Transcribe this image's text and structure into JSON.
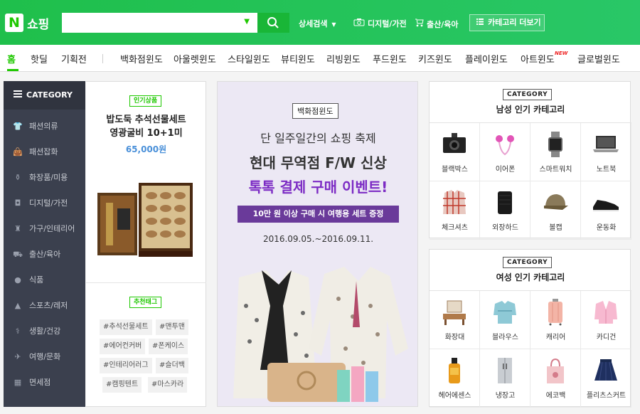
{
  "header": {
    "logo_letter": "N",
    "brand": "쇼핑",
    "search_value": "",
    "detail_search": "상세검색",
    "links": [
      {
        "label": "디지털/가전",
        "icon": "camera-icon"
      },
      {
        "label": "출산/육아",
        "icon": "stroller-icon"
      }
    ],
    "category_more": "카테고리 더보기"
  },
  "nav": {
    "items": [
      "홈",
      "핫딜",
      "기획전",
      "백화점윈도",
      "아울렛윈도",
      "스타일윈도",
      "뷰티윈도",
      "리빙윈도",
      "푸드윈도",
      "키즈윈도",
      "플레이윈도",
      "아트윈도",
      "글로벌윈도"
    ],
    "active": "홈",
    "new_badge": "NEW"
  },
  "sidebar": {
    "header": "CATEGORY",
    "items": [
      "패션의류",
      "패션잡화",
      "화장품/미용",
      "디지털/가전",
      "가구/인테리어",
      "출산/육아",
      "식품",
      "스포츠/레저",
      "생활/건강",
      "여행/문화",
      "면세점"
    ]
  },
  "featured": {
    "badge": "인기상품",
    "title_line1": "밥도둑 추석선물세트",
    "title_line2": "영광굴비 10+1미",
    "price": "65,000원",
    "tag_badge": "추천태그",
    "tags": [
      "#추석선물세트",
      "#맨투맨",
      "#에어컨커버",
      "#폰케이스",
      "#인테리어러그",
      "#슬더백",
      "#캠핑텐트",
      "#마스카라"
    ]
  },
  "banner": {
    "badge": "백화점윈도",
    "line1": "단 일주일간의 쇼핑 축제",
    "line2": "현대 무역점 F/W 신상",
    "line3": "톡톡 결제 구매 이벤트!",
    "strip": "10만 원 이상 구매 시 여행용 세트 증정",
    "date": "2016.09.05.~2016.09.11."
  },
  "men_category": {
    "badge": "CATEGORY",
    "title": "남성 인기 카테고리",
    "items": [
      "블랙박스",
      "이어폰",
      "스마트워치",
      "노트북",
      "체크셔츠",
      "외장하드",
      "볼캡",
      "운동화"
    ]
  },
  "women_category": {
    "badge": "CATEGORY",
    "title": "여성 인기 카테고리",
    "items": [
      "화장대",
      "블라우스",
      "캐리어",
      "카디건",
      "헤어에센스",
      "냉장고",
      "에코백",
      "플리츠스커트"
    ]
  },
  "colors": {
    "brand_green": "#1ec800",
    "sidebar_bg": "#3b404e",
    "banner_purple": "#7c2bc4"
  }
}
